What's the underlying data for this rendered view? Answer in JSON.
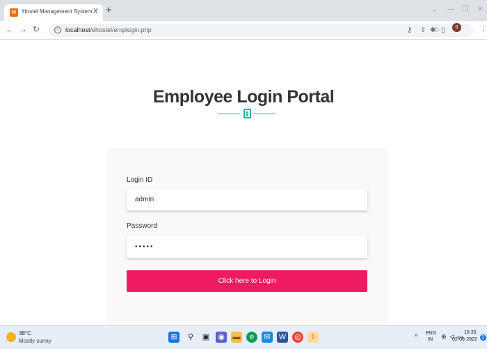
{
  "browser": {
    "tab_title": "Hostel Management System",
    "tab_close": "X",
    "new_tab": "+",
    "url_host": "localhost",
    "url_path": "/ehostel/emplogin.php",
    "profile_initial": "0"
  },
  "page": {
    "heading": "Employee Login Portal",
    "login_id_label": "Login ID",
    "login_id_value": "admin",
    "password_label": "Password",
    "password_value": "•••••",
    "login_button": "Click here to Login",
    "accent_color": "#1cb5a3",
    "button_color": "#ef1a5f"
  },
  "taskbar": {
    "weather_temp": "38°C",
    "weather_desc": "Mostly sunny",
    "lang_top": "ENG",
    "lang_bottom": "IN",
    "time": "15:35",
    "date": "02-06-2022",
    "notification_count": "2"
  }
}
